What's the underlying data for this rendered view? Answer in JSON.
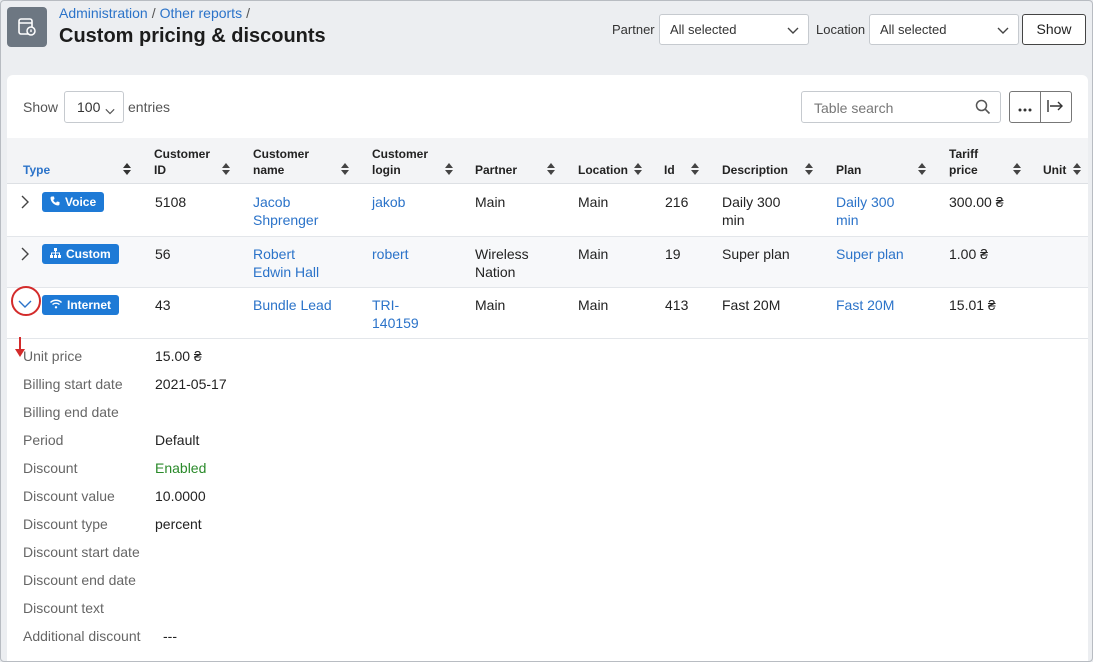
{
  "breadcrumb": [
    "Administration",
    "Other reports"
  ],
  "page_title": "Custom pricing & discounts",
  "filters": {
    "partner_label": "Partner",
    "partner_value": "All selected",
    "location_label": "Location",
    "location_value": "All selected",
    "show_label": "Show"
  },
  "table_controls": {
    "show_label": "Show",
    "entries_value": "100",
    "entries_suffix": "entries",
    "search_placeholder": "Table search"
  },
  "columns": [
    "Type",
    "Customer ID",
    "Customer name",
    "Customer login",
    "Partner",
    "Location",
    "Id",
    "Description",
    "Plan",
    "Tariff price",
    "Unit"
  ],
  "rows": [
    {
      "type": "Voice",
      "customer_id": "5108",
      "customer_name": [
        "Jacob",
        "Shprenger"
      ],
      "customer_login": [
        "jakob"
      ],
      "partner": [
        "Main"
      ],
      "location": "Main",
      "id": "216",
      "description": [
        "Daily 300",
        "min"
      ],
      "plan": [
        "Daily 300",
        "min"
      ],
      "tariff_price": "300.00 ₴"
    },
    {
      "type": "Custom",
      "customer_id": "56",
      "customer_name": [
        "Robert",
        "Edwin Hall"
      ],
      "customer_login": [
        "robert"
      ],
      "partner": [
        "Wireless",
        "Nation"
      ],
      "location": "Main",
      "id": "19",
      "description": [
        "Super plan"
      ],
      "plan": [
        "Super plan"
      ],
      "tariff_price": "1.00 ₴"
    },
    {
      "type": "Internet",
      "customer_id": "43",
      "customer_name": [
        "Bundle Lead"
      ],
      "customer_login": [
        "TRI-",
        "140159"
      ],
      "partner": [
        "Main"
      ],
      "location": "Main",
      "id": "413",
      "description": [
        "Fast 20M"
      ],
      "plan": [
        "Fast 20M"
      ],
      "tariff_price": "15.01 ₴"
    }
  ],
  "details": [
    {
      "label": "Unit price",
      "value": "15.00 ₴"
    },
    {
      "label": "Billing start date",
      "value": "2021-05-17"
    },
    {
      "label": "Billing end date",
      "value": ""
    },
    {
      "label": "Period",
      "value": "Default"
    },
    {
      "label": "Discount",
      "value": "Enabled"
    },
    {
      "label": "Discount value",
      "value": "10.0000"
    },
    {
      "label": "Discount type",
      "value": "percent"
    },
    {
      "label": "Discount start date",
      "value": ""
    },
    {
      "label": "Discount end date",
      "value": ""
    },
    {
      "label": "Discount text",
      "value": ""
    },
    {
      "label": "Additional discount",
      "value": "---"
    }
  ],
  "colors": {
    "accent": "#2b73c9",
    "badge": "#1e7ad6",
    "enabled": "#2a8a2a",
    "highlight": "#d32b2b"
  }
}
